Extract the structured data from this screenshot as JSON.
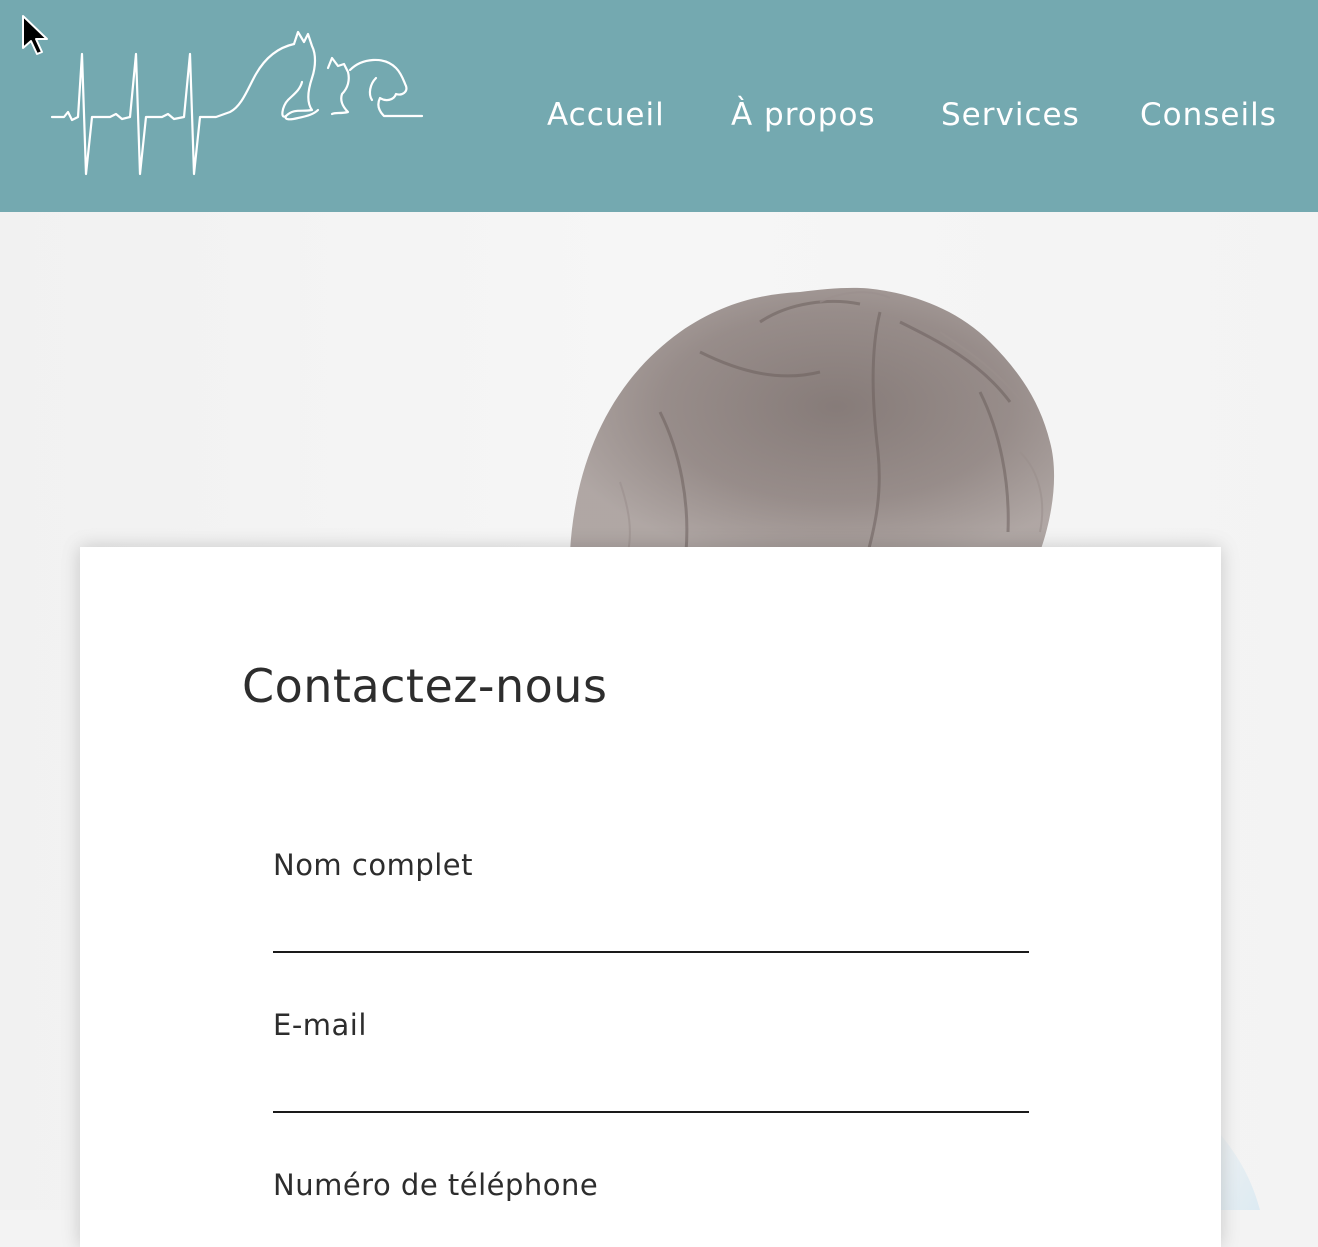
{
  "header": {
    "background_color": "#74a9b0",
    "logo_icon": "heartbeat-animals-logo-icon"
  },
  "nav": {
    "items": [
      {
        "label": "Accueil"
      },
      {
        "label": "À propos"
      },
      {
        "label": "Services"
      },
      {
        "label": "Conseils"
      }
    ]
  },
  "hero": {
    "image": "person-hair-photo"
  },
  "contact_form": {
    "title": "Contactez-nous",
    "fields": [
      {
        "label": "Nom complet",
        "value": ""
      },
      {
        "label": "E-mail",
        "value": ""
      },
      {
        "label": "Numéro de téléphone",
        "value": ""
      }
    ]
  }
}
